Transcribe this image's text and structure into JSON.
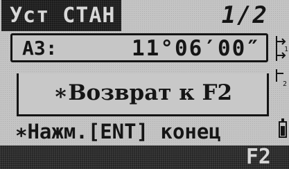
{
  "header": {
    "title": "Уст СТАН",
    "page": "1/2"
  },
  "field": {
    "label": "АЗ:",
    "value": "11°06′00″"
  },
  "message": "∗Возврат к F2",
  "prompt": "∗Нажм.[ENT] конец",
  "softkeys": {
    "f2": "F2"
  },
  "icons": {
    "battery": "battery-icon",
    "side_marks": "axis-marker-icons"
  }
}
